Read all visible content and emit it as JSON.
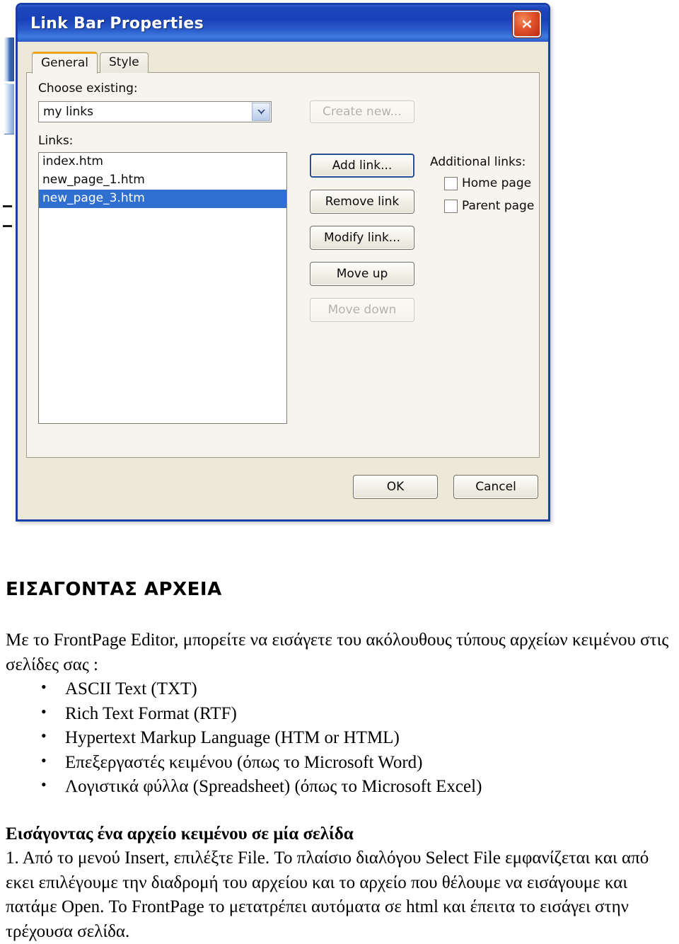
{
  "dialog": {
    "title": "Link Bar Properties",
    "close_icon": "close-x-icon",
    "tabs": [
      {
        "label": "General",
        "active": true
      },
      {
        "label": "Style",
        "active": false
      }
    ],
    "general": {
      "choose_existing_label": "Choose existing:",
      "combo_value": "my links",
      "combo_arrow_icon": "chevron-down-icon",
      "create_new_label": "Create new...",
      "create_new_enabled": false,
      "links_label": "Links:",
      "links": [
        {
          "name": "index.htm",
          "selected": false
        },
        {
          "name": "new_page_1.htm",
          "selected": false
        },
        {
          "name": "new_page_3.htm",
          "selected": true
        }
      ],
      "buttons": [
        {
          "label": "Add link...",
          "enabled": true,
          "default": true
        },
        {
          "label": "Remove link",
          "enabled": true,
          "default": false
        },
        {
          "label": "Modify link...",
          "enabled": true,
          "default": false
        },
        {
          "label": "Move up",
          "enabled": true,
          "default": false
        },
        {
          "label": "Move down",
          "enabled": false,
          "default": false
        }
      ],
      "additional_links_label": "Additional links:",
      "checkboxes": [
        {
          "label": "Home page",
          "checked": false
        },
        {
          "label": "Parent page",
          "checked": false
        }
      ]
    },
    "footer": {
      "ok_label": "OK",
      "cancel_label": "Cancel"
    },
    "colors": {
      "titlebar_blue": "#1a42b8",
      "selection_blue": "#2f6fd0",
      "active_tab_accent": "#e8a317",
      "dialog_face": "#ece9d8"
    }
  },
  "document": {
    "heading": "ΕΙΣΑΓΟΝΤΑΣ ΑΡΧΕΙΑ",
    "intro": "Με το FrontPage Editor, μπορείτε να εισάγετε του ακόλουθους τύπους αρχείων κειμένου στις σελίδες σας :",
    "file_types": [
      "ASCII Text (TXT)",
      "Rich Text Format (RTF)",
      "Hypertext Markup Language (HTM or HTML)",
      "Επεξεργαστές κειμένου (όπως το Microsoft Word)",
      "Λογιστικά φύλλα (Spreadsheet) (όπως το Microsoft Excel)"
    ],
    "subheading": "Εισάγοντας ένα αρχείο κειμένου σε μία σελίδα",
    "steps": "1. Από το μενού Insert, επιλέξτε File. Το πλαίσιο διαλόγου Select File εμφανίζεται και από εκει επιλέγουμε την διαδρομή του αρχείου και το αρχείο που θέλουμε να εισάγουμε και πατάμε Open. Το FrontPage το μετατρέπει αυτόματα σε html και έπειτα το εισάγει στην τρέχουσα σελίδα."
  }
}
